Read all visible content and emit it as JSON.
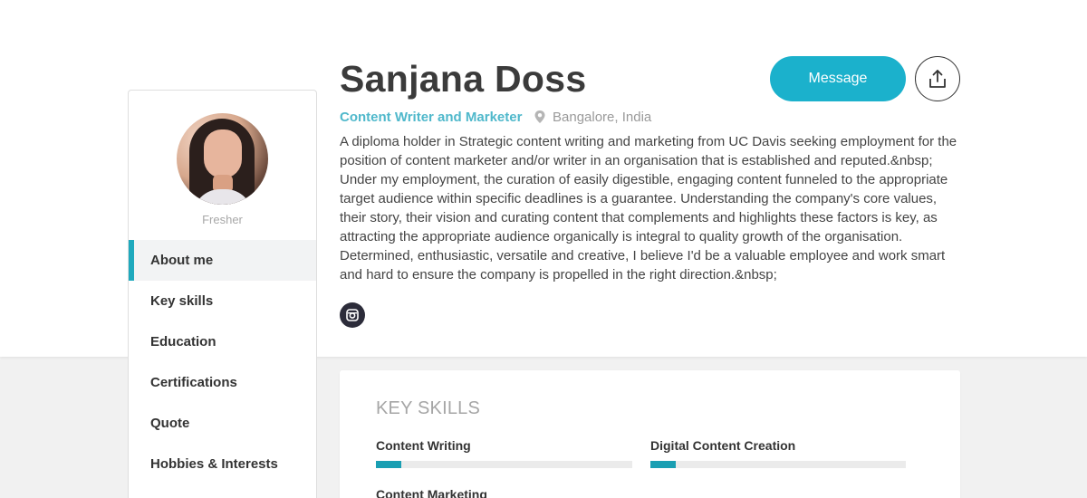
{
  "profile": {
    "name": "Sanjana Doss",
    "role": "Content Writer and Marketer",
    "location": "Bangalore, India",
    "level": "Fresher",
    "bio": "A diploma holder in Strategic content writing and marketing from UC Davis seeking employment for the position of content marketer and/or writer in an organisation that is established and reputed.&nbsp; Under my employment, the curation of easily digestible, engaging content funneled to the appropriate target audience within specific deadlines is a guarantee. Understanding the company's core values, their story, their vision and curating content that complements and highlights these factors is key, as attracting the appropriate audience organically is integral to quality growth of the organisation. Determined, enthusiastic, versatile and creative, I believe I'd be a valuable employee and work smart and hard to ensure the company is propelled in the right direction.&nbsp;"
  },
  "actions": {
    "message_label": "Message",
    "share_icon": "share-icon",
    "social_icon": "instagram-icon"
  },
  "sidebar": {
    "items": [
      {
        "label": "About me",
        "active": true
      },
      {
        "label": "Key skills"
      },
      {
        "label": "Education"
      },
      {
        "label": "Certifications"
      },
      {
        "label": "Quote"
      },
      {
        "label": "Hobbies & Interests"
      }
    ]
  },
  "skills": {
    "title": "KEY SKILLS",
    "items": [
      {
        "name": "Content Writing",
        "level": 0.1
      },
      {
        "name": "Digital Content Creation",
        "level": 0.1
      },
      {
        "name": "Content Marketing"
      }
    ]
  },
  "colors": {
    "accent": "#1bb1cc",
    "role": "#4fb8cb",
    "skill_fill": "#1a9fb3"
  }
}
